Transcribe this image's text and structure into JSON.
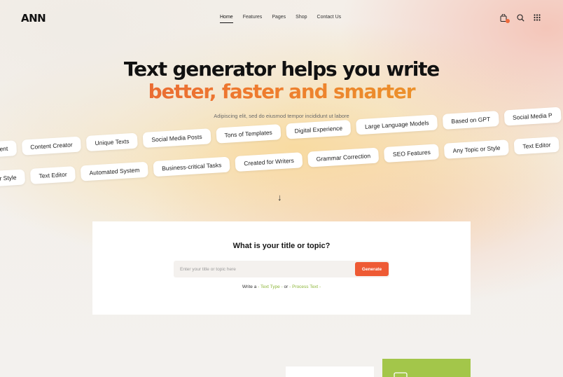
{
  "header": {
    "logo": "ANN",
    "nav": [
      {
        "label": "Home",
        "active": true
      },
      {
        "label": "Features",
        "active": false
      },
      {
        "label": "Pages",
        "active": false
      },
      {
        "label": "Shop",
        "active": false
      },
      {
        "label": "Contact Us",
        "active": false
      }
    ],
    "icons": [
      "bag-icon",
      "search-icon",
      "grid-menu-icon"
    ]
  },
  "hero": {
    "title_line1": "Text generator helps you write",
    "title_line2": "better, faster and smarter",
    "subtitle": "Adipiscing elit, sed do eiusmod tempor incididunt ut labore"
  },
  "tags_row1": [
    "ty Content",
    "Content Creator",
    "Unique Texts",
    "Social Media Posts",
    "Tons of Templates",
    "Digital Experience",
    "Large Language Models",
    "Based on GPT",
    "Social Media P"
  ],
  "tags_row2": [
    "Topic or Style",
    "Text Editor",
    "Automated System",
    "Business-critical Tasks",
    "Created for Writers",
    "Grammar Correction",
    "SEO Features",
    "Any Topic or Style",
    "Text Editor"
  ],
  "form": {
    "heading": "What is your title or topic?",
    "placeholder": "Enter your title or topic here",
    "value": "",
    "button": "Generate",
    "write_prefix": "Write a",
    "text_type": "- Text Type -",
    "or": "or",
    "process_text": "- Process Text -"
  },
  "colors": {
    "accent": "#ee5a34",
    "green": "#8db63a"
  }
}
